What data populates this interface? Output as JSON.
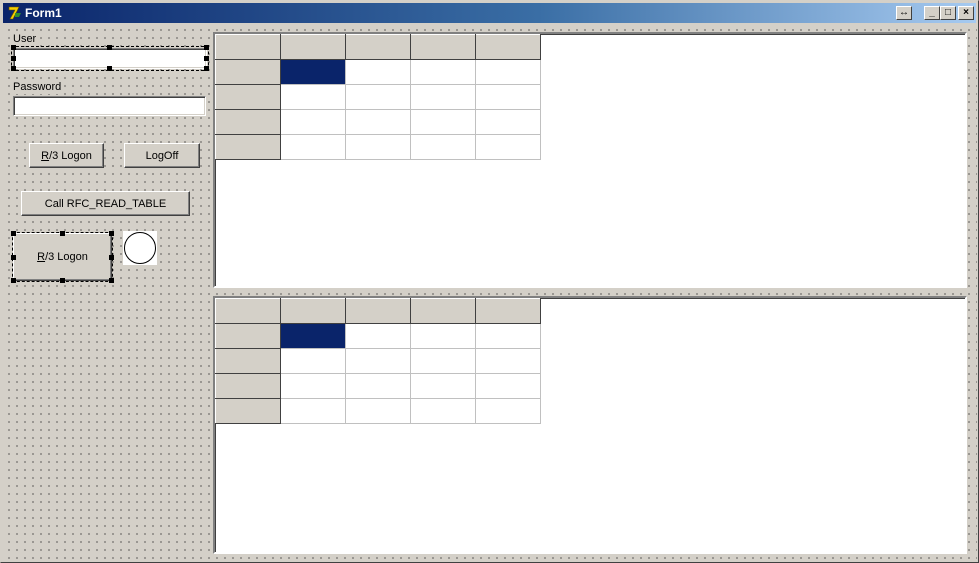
{
  "window": {
    "title": "Form1",
    "icon": "delphi-app-icon",
    "buttons": {
      "extra": "↔",
      "minimize": "_",
      "maximize": "□",
      "close": "×"
    }
  },
  "form": {
    "user_label": "User",
    "user_value": "",
    "password_label": "Password",
    "password_value": "",
    "logon_button": {
      "prefix": "R",
      "rest": "/3 Logon"
    },
    "logoff_button": "LogOff",
    "call_button": "Call RFC_READ_TABLE",
    "logon_button_2": {
      "prefix": "R",
      "rest": "/3 Logon"
    },
    "status_shape": "circle"
  },
  "grids": {
    "rows": 5,
    "cols": 5,
    "fixed_rows": 1,
    "fixed_cols": 1,
    "selected_cell": [
      1,
      1
    ],
    "accent": "#0a246a"
  }
}
